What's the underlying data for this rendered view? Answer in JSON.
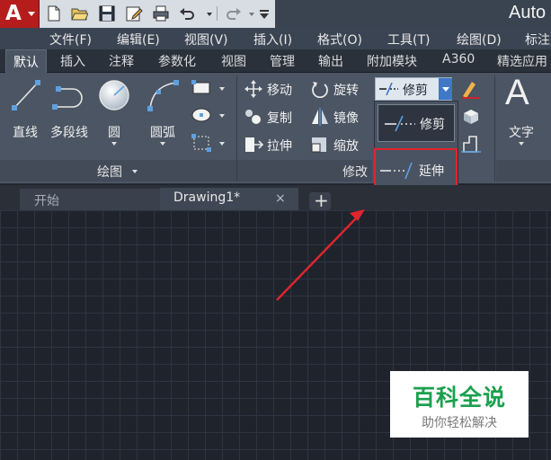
{
  "title_bar": {
    "app_title": "Auto"
  },
  "quick_access": {
    "icons": [
      "new-icon",
      "open-icon",
      "save-icon",
      "save-as-icon",
      "print-icon",
      "undo-icon",
      "redo-icon",
      "customize-icon"
    ]
  },
  "menu": {
    "items": [
      "文件(F)",
      "编辑(E)",
      "视图(V)",
      "插入(I)",
      "格式(O)",
      "工具(T)",
      "绘图(D)",
      "标注"
    ]
  },
  "ribbon_tabs": {
    "items": [
      "默认",
      "插入",
      "注释",
      "参数化",
      "视图",
      "管理",
      "输出",
      "附加模块",
      "A360",
      "精选应用"
    ],
    "active": "默认"
  },
  "draw_panel": {
    "title": "绘图",
    "tools": {
      "line": "直线",
      "polyline": "多段线",
      "circle": "圆",
      "arc": "圆弧"
    }
  },
  "modify_panel": {
    "title": "修改",
    "tools": {
      "move": "移动",
      "rotate": "旋转",
      "copy": "复制",
      "mirror": "镜像",
      "stretch": "拉伸",
      "scale": "缩放"
    },
    "trim_button": "修剪",
    "dropdown": {
      "trim": "修剪",
      "extend": "延伸"
    }
  },
  "annotation_panel": {
    "text_tool": "文字",
    "text_glyph": "A"
  },
  "doc_tabs": {
    "start": "开始",
    "drawing": "Drawing1*",
    "close_glyph": "×",
    "new_tab_glyph": "+"
  },
  "watermark": {
    "title": "百科全说",
    "subtitle": "助你轻松解决"
  },
  "colors": {
    "accent_red": "#e0252d",
    "logo_red": "#b51d1d",
    "watermark_green": "#1aa04d",
    "canvas_bg": "#1f232c",
    "ribbon_bg": "#4b5563"
  }
}
